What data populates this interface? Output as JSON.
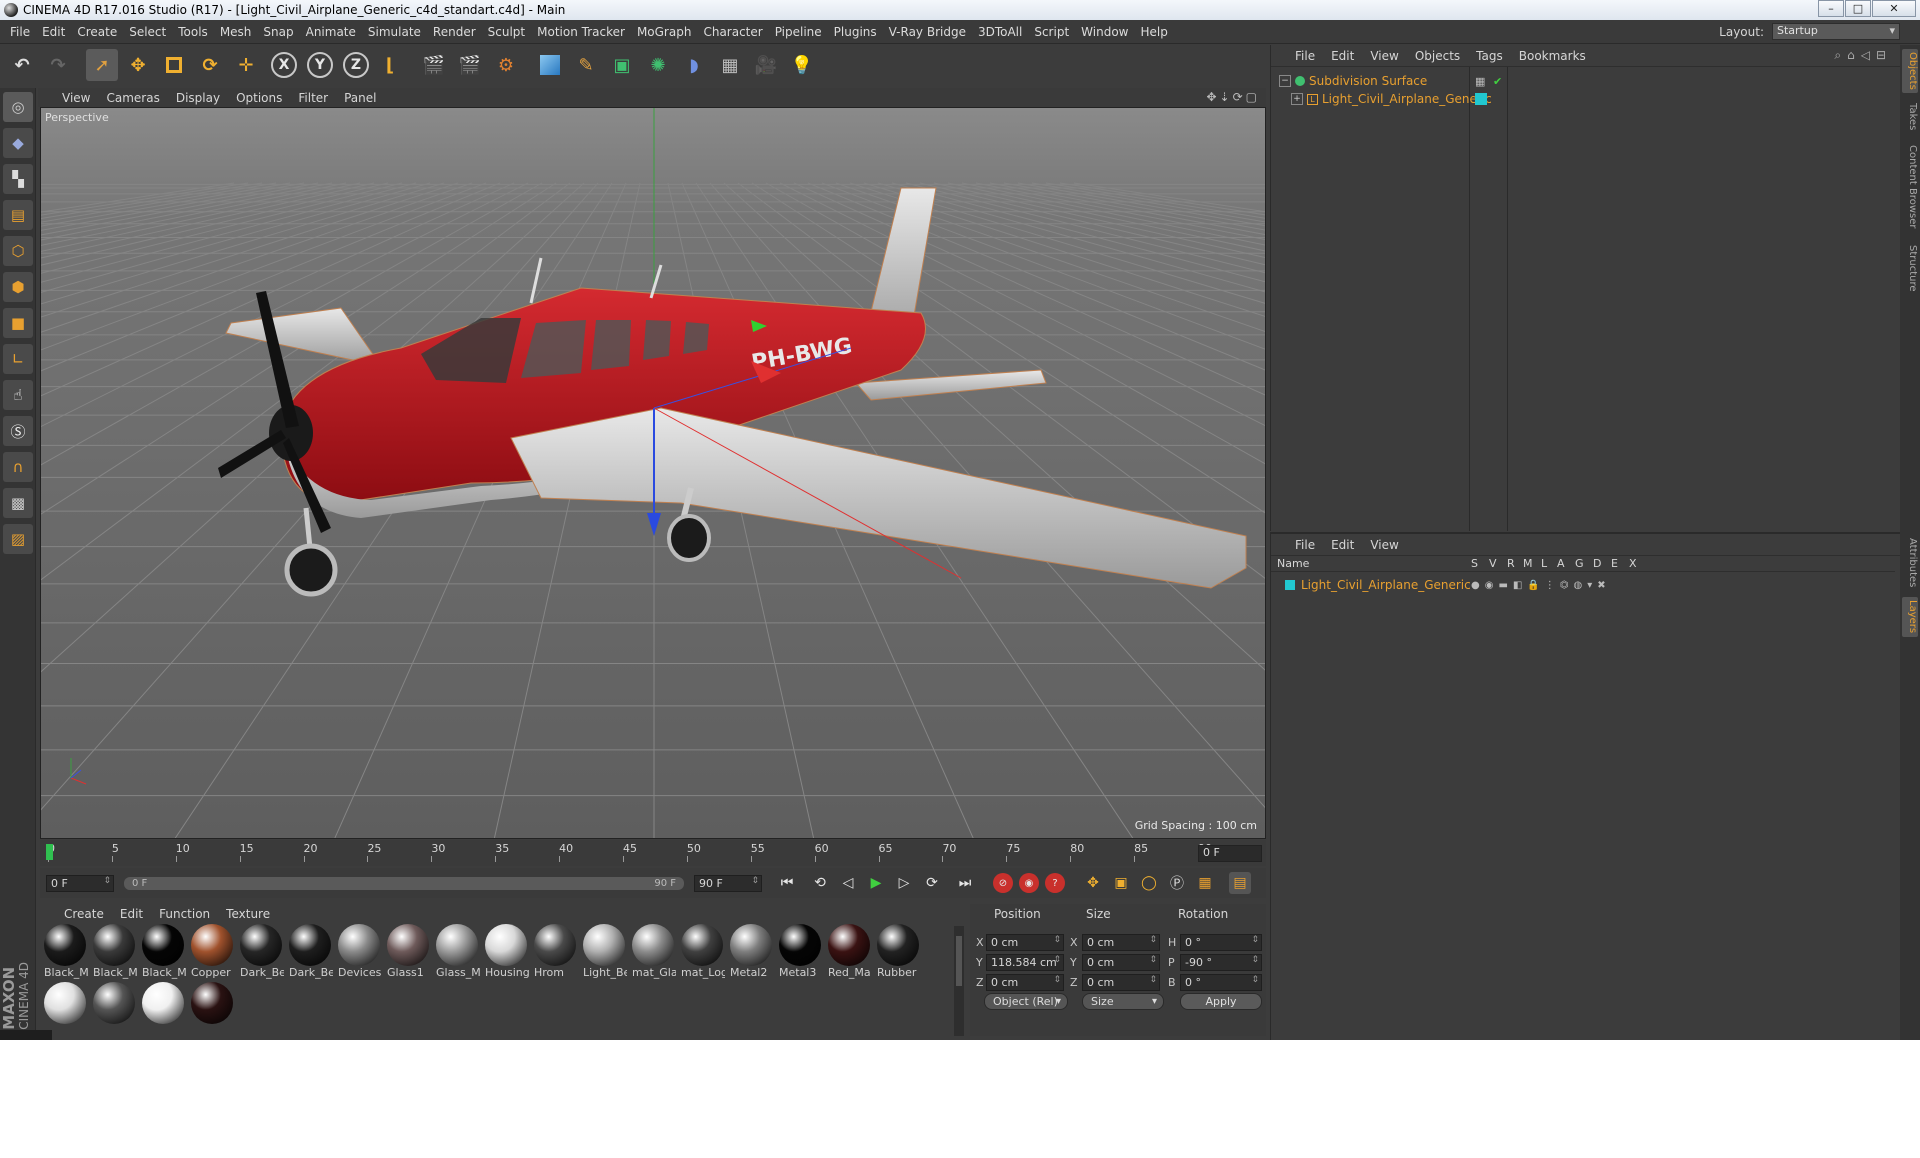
{
  "window": {
    "title": "CINEMA 4D R17.016 Studio (R17) - [Light_Civil_Airplane_Generic_c4d_standart.c4d] - Main",
    "buttons": [
      "–",
      "□",
      "✕"
    ]
  },
  "menubar": {
    "items": [
      "File",
      "Edit",
      "Create",
      "Select",
      "Tools",
      "Mesh",
      "Snap",
      "Animate",
      "Simulate",
      "Render",
      "Sculpt",
      "Motion Tracker",
      "MoGraph",
      "Character",
      "Pipeline",
      "Plugins",
      "V-Ray Bridge",
      "3DToAll",
      "Script",
      "Window",
      "Help"
    ],
    "layout_label": "Layout:",
    "layout_value": "Startup"
  },
  "toolbar": {
    "axis_labels": [
      "X",
      "Y",
      "Z"
    ]
  },
  "viewport": {
    "menu": [
      "View",
      "Cameras",
      "Display",
      "Options",
      "Filter",
      "Panel"
    ],
    "label": "Perspective",
    "grid_spacing": "Grid Spacing : 100 cm",
    "tail_number": "PH-BWG",
    "colors": {
      "fuselage": "#b3141e",
      "metal": "#c8c8c8",
      "bg": "#6a6a6a"
    }
  },
  "timeline": {
    "ticks": [
      "0",
      "5",
      "10",
      "15",
      "20",
      "25",
      "30",
      "35",
      "40",
      "45",
      "50",
      "55",
      "60",
      "65",
      "70",
      "75",
      "80",
      "85",
      "90"
    ],
    "end_frame": "0 F",
    "start_field": "0 F",
    "range_start": "0 F",
    "range_end": "90 F",
    "max_field": "90 F"
  },
  "materials": {
    "menu": [
      "Create",
      "Edit",
      "Function",
      "Texture"
    ],
    "items": [
      {
        "label": "Black_M",
        "color": "#1b1b1b"
      },
      {
        "label": "Black_M",
        "color": "#3a3a3a"
      },
      {
        "label": "Black_M",
        "color": "#050505"
      },
      {
        "label": "Copper",
        "color": "#a0522d"
      },
      {
        "label": "Dark_Be",
        "color": "#262626"
      },
      {
        "label": "Dark_Be",
        "color": "#1e1e1e"
      },
      {
        "label": "Devices",
        "color": "#8a8a8a"
      },
      {
        "label": "Glass1",
        "color": "#6e5a5a"
      },
      {
        "label": "Glass_M",
        "color": "#9c9c9c"
      },
      {
        "label": "Housing",
        "color": "#d8d8d8"
      },
      {
        "label": "Hrom",
        "color": "#4a4a4a"
      },
      {
        "label": "Light_Be",
        "color": "#b0b0b0"
      },
      {
        "label": "mat_Gla",
        "color": "#8c8c8c"
      },
      {
        "label": "mat_Log",
        "color": "#404040"
      },
      {
        "label": "Metal2",
        "color": "#7e7e7e"
      },
      {
        "label": "Metal3",
        "color": "#050505"
      },
      {
        "label": "Red_Ma",
        "color": "#3a1212"
      },
      {
        "label": "Rubber",
        "color": "#222222"
      },
      {
        "label": "",
        "color": "#e0e0e0"
      },
      {
        "label": "",
        "color": "#555555"
      },
      {
        "label": "",
        "color": "#f0f0f0"
      },
      {
        "label": "",
        "color": "#2a1212"
      }
    ]
  },
  "coords": {
    "headers": {
      "position": "Position",
      "size": "Size",
      "rotation": "Rotation"
    },
    "pos": {
      "x": "0 cm",
      "y": "118.584 cm",
      "z": "0 cm"
    },
    "size": {
      "x": "0 cm",
      "y": "0 cm",
      "z": "0 cm"
    },
    "rot": {
      "h": "0 °",
      "p": "-90 °",
      "b": "0 °"
    },
    "axis": {
      "x": "X",
      "y": "Y",
      "z": "Z",
      "h": "H",
      "p": "P",
      "b": "B"
    },
    "mode": "Object (Rel)",
    "size_mode": "Size",
    "apply": "Apply"
  },
  "object_manager": {
    "menu": [
      "File",
      "Edit",
      "View",
      "Objects",
      "Tags",
      "Bookmarks"
    ],
    "objects": [
      {
        "name": "Subdivision Surface",
        "color": "#e8a030"
      },
      {
        "name": "Light_Civil_Airplane_Generic",
        "color": "#e8a030"
      }
    ]
  },
  "layer_manager": {
    "menu": [
      "File",
      "Edit",
      "View"
    ],
    "columns": [
      "Name",
      "S",
      "V",
      "R",
      "M",
      "L",
      "A",
      "G",
      "D",
      "E",
      "X"
    ],
    "layers": [
      {
        "name": "Light_Civil_Airplane_Generic",
        "color": "#e8a030",
        "swatch": "#22c8d0"
      }
    ]
  },
  "side_tabs": [
    "Objects",
    "Takes",
    "Content Browser",
    "Structure",
    "Attributes",
    "Layers"
  ],
  "branding": {
    "maxon": "MAXON",
    "product": "CINEMA 4D"
  }
}
